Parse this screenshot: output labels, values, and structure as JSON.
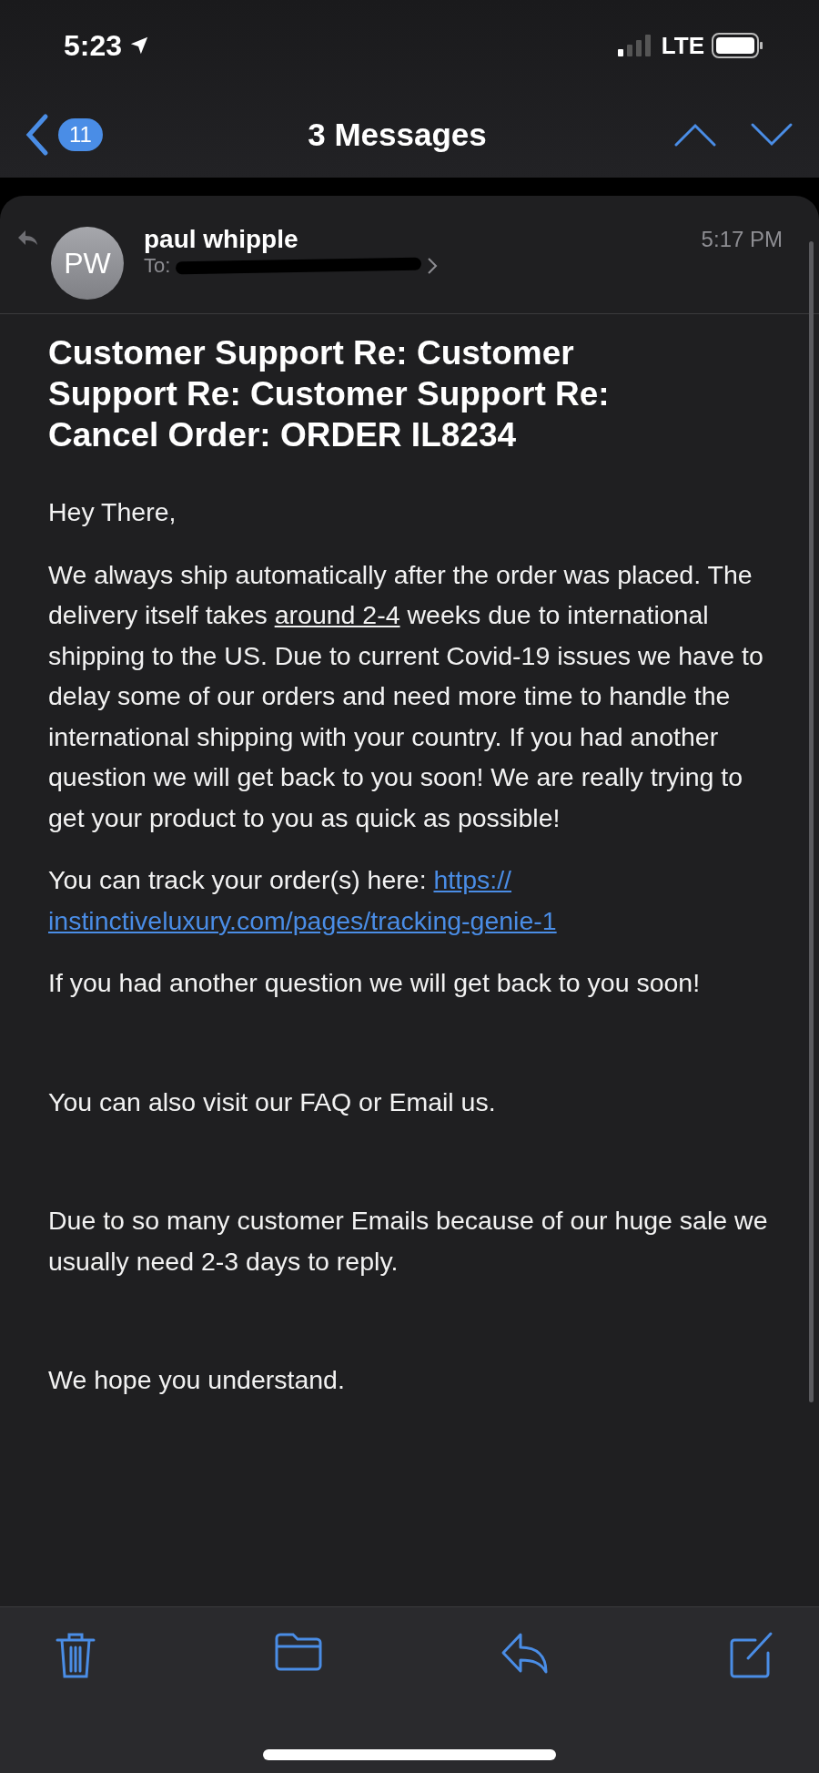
{
  "status_bar": {
    "time": "5:23",
    "network": "LTE"
  },
  "nav": {
    "unread_count": "11",
    "title": "3 Messages"
  },
  "message": {
    "avatar_initials": "PW",
    "sender": "paul whipple",
    "to_label": "To:",
    "time": "5:17 PM",
    "subject": "Customer Support Re: Customer Support Re: Customer Support Re: Cancel Order: ORDER IL8234",
    "body": [
      {
        "kind": "text",
        "text": "Hey There,"
      },
      {
        "kind": "detected",
        "before": "We always ship automatically after the order was placed. The delivery itself takes ",
        "detected": "around 2-4",
        "after": " weeks due to international shipping to the US. Due to current Covid-19 issues we have to delay some of our orders and need more time to handle the international shipping with your country. If you had another question we will get back to you soon! We are really trying to get your product to you as quick as possible!"
      },
      {
        "kind": "link",
        "before": "You can track your order(s) here: ",
        "link_lines": [
          "https://",
          "instinctiveluxury.com/pages/tracking-genie-1"
        ]
      },
      {
        "kind": "text",
        "text": "If you had another question we will get back to you soon!"
      },
      {
        "kind": "spacer"
      },
      {
        "kind": "text",
        "text": "You can also visit our FAQ or Email us."
      },
      {
        "kind": "spacer"
      },
      {
        "kind": "text",
        "text": "Due to so many customer Emails because of our huge sale we usually need 2-3 days to reply."
      },
      {
        "kind": "spacer"
      },
      {
        "kind": "text",
        "text": "We hope you understand."
      }
    ]
  }
}
